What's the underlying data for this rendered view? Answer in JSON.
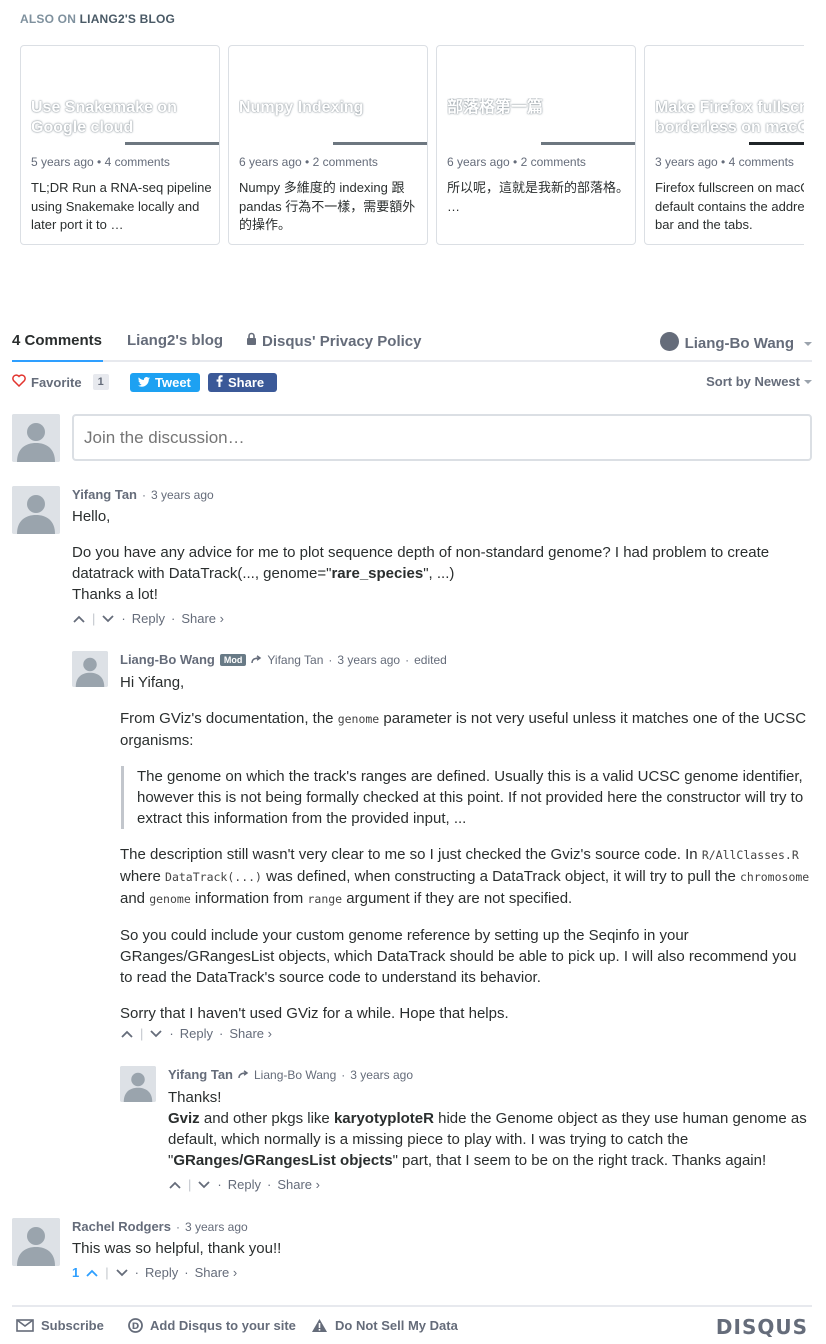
{
  "also_on": {
    "prefix": "ALSO ON",
    "blog": "LIANG2'S BLOG",
    "cards": [
      {
        "title": "Use Snakemake on\nGoogle cloud",
        "meta": "5 years ago • 4 comments",
        "excerpt": "TL;DR Run a RNA-seq pipeline using Snakemake locally and later port it to …"
      },
      {
        "title": "Numpy Indexing",
        "meta": "6 years ago • 2 comments",
        "excerpt": "Numpy 多維度的 indexing 跟 pandas 行為不一樣，需要額外的操作。"
      },
      {
        "title": "部落格第一篇",
        "meta": "6 years ago • 2 comments",
        "excerpt": "所以呢，這就是我新的部落格。 …"
      },
      {
        "title": "Make Firefox fullscreen\nborderless on macOS",
        "meta": "3 years ago • 4 comments",
        "excerpt": "Firefox fullscreen on macOS by default contains the address bar and the tabs."
      }
    ]
  },
  "nav": {
    "comments_tab": "4 Comments",
    "blog_tab": "Liang2's blog",
    "privacy_tab": "Disqus' Privacy Policy",
    "user": "Liang-Bo Wang"
  },
  "toolbar": {
    "favorite_label": "Favorite",
    "favorite_count": "1",
    "tweet_label": "Tweet",
    "share_label": "Share",
    "sort_label": "Sort by Newest"
  },
  "composer": {
    "placeholder": "Join the discussion…"
  },
  "comments": [
    {
      "author": "Yifang Tan",
      "time": "3 years ago",
      "line1": "Hello,",
      "line2a": "Do you have any advice for me to plot sequence depth of non-standard genome? I had problem to create datatrack with DataTrack(..., genome=\"",
      "line2b": "rare_species",
      "line2c": "\", ...)",
      "line3": "Thanks a lot!",
      "reply": "Reply",
      "share": "Share ›"
    },
    {
      "author": "Liang-Bo Wang",
      "badge": "Mod",
      "reply_to": "Yifang Tan",
      "time": "3 years ago",
      "edited": "edited",
      "p1": "Hi Yifang,",
      "p2a": "From GViz's documentation, the ",
      "p2code": "genome",
      "p2b": " parameter is not very useful unless it matches one of the UCSC organisms:",
      "quote": "The genome on which the track's ranges are defined. Usually this is a valid UCSC genome identifier, however this is not being formally checked at this point. If not provided here the constructor will try to extract this information from the provided input, ...",
      "p3a": "The description still wasn't very clear to me so I just checked the Gviz's source code. In ",
      "p3code1": "R/AllClasses.R",
      "p3b": "where ",
      "p3code2": "DataTrack(...)",
      "p3c": " was defined, when constructing a DataTrack object, it will try to pull the ",
      "p3code3": "chromosome",
      "p3d": " and ",
      "p3code4": "genome",
      "p3e": " information from ",
      "p3code5": "range",
      "p3f": " argument if they are not specified.",
      "p4": "So you could include your custom genome reference by setting up the Seqinfo in your GRanges/GRangesList objects, which DataTrack should be able to pick up. I will also recommend you to read the DataTrack's source code to understand its behavior.",
      "p5": "Sorry that I haven't used GViz for a while. Hope that helps.",
      "reply": "Reply",
      "share": "Share ›"
    },
    {
      "author": "Yifang Tan",
      "reply_to": "Liang-Bo Wang",
      "time": "3 years ago",
      "l1": "Thanks!",
      "l2a": "Gviz",
      "l2b": " and other pkgs like ",
      "l2c": "karyotyploteR",
      "l2d": " hide the Genome object as they use human genome as default, which normally is a missing piece to play with. I was trying to catch the \"",
      "l2e": "GRanges/GRangesList objects",
      "l2f": "\" part, that I seem to be on the right track. Thanks again!",
      "reply": "Reply",
      "share": "Share ›"
    },
    {
      "author": "Rachel Rodgers",
      "time": "3 years ago",
      "text": "This was so helpful, thank you!!",
      "votes": "1",
      "reply": "Reply",
      "share": "Share ›"
    }
  ],
  "footer": {
    "subscribe": "Subscribe",
    "add_disqus": "Add Disqus to your site",
    "do_not_sell": "Do Not Sell My Data",
    "logo": "DISQUS"
  },
  "colors": {
    "accent": "#2e9fff",
    "twitter": "#1da1f2",
    "facebook": "#3b5998",
    "favorite_heart": "#e2352f"
  }
}
